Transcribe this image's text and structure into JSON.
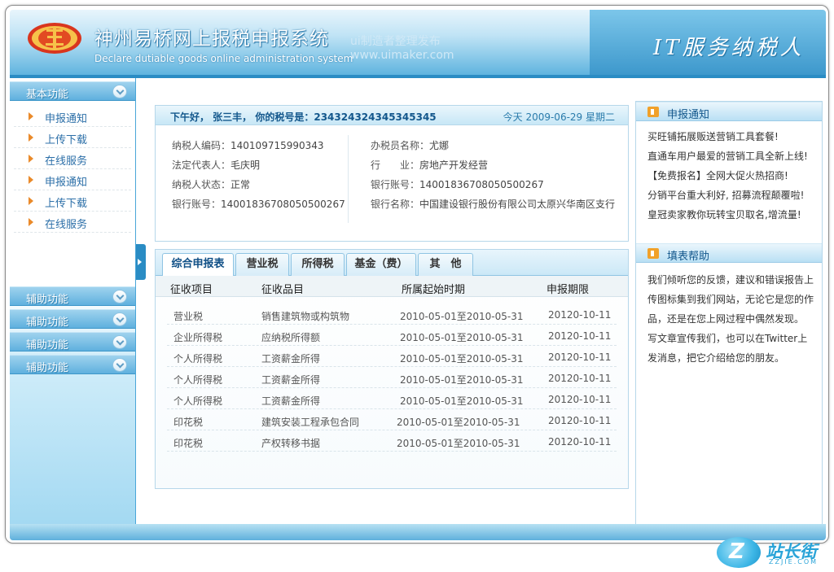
{
  "header": {
    "title": "神州易桥网上报税申报系统",
    "subtitle": "Declare dutiable goods online administration system",
    "watermark_line1": "ui制造者整理发布",
    "watermark_line2": "www.uimaker.com",
    "slogan": "IT服务纳税人",
    "logo_icon": "tax-emblem-icon"
  },
  "sidebar": {
    "basic_title": "基本功能",
    "items": [
      {
        "label": "申报通知"
      },
      {
        "label": "上传下载"
      },
      {
        "label": "在线服务"
      },
      {
        "label": "申报通知"
      },
      {
        "label": "上传下载"
      },
      {
        "label": "在线服务"
      }
    ],
    "aux_sections": [
      {
        "label": "辅助功能"
      },
      {
        "label": "辅助功能"
      },
      {
        "label": "辅助功能"
      },
      {
        "label": "辅助功能"
      }
    ]
  },
  "info": {
    "greeting": "下午好，   张三丰， 你的税号是：234324324345345345",
    "date": "今天  2009-06-29  星期二",
    "left": [
      {
        "key": "纳税人编码：",
        "value": "140109715990343"
      },
      {
        "key": "法定代表人：",
        "value": "毛庆明"
      },
      {
        "key": "纳税人状态：",
        "value": "正常"
      },
      {
        "key": "银行账号：",
        "value": "14001836708050500267"
      }
    ],
    "right": [
      {
        "key": "办税员名称：",
        "value": "尤娜"
      },
      {
        "key": "行　　业：",
        "value": "房地产开发经营"
      },
      {
        "key": "银行账号：",
        "value": "14001836708050500267"
      },
      {
        "key": "银行名称：",
        "value": "中国建设银行股份有限公司太原兴华南区支行"
      }
    ]
  },
  "tabs": [
    {
      "label": "综合申报表",
      "active": true
    },
    {
      "label": "营业税",
      "active": false
    },
    {
      "label": "所得税",
      "active": false
    },
    {
      "label": "基金（费）",
      "active": false
    },
    {
      "label": "其　他",
      "active": false
    }
  ],
  "table": {
    "columns": [
      "征收项目",
      "征收品目",
      "所属起始时期",
      "申报期限"
    ],
    "rows": [
      [
        "营业税",
        "销售建筑物或构筑物",
        "2010-05-01至2010-05-31",
        "20120-10-11"
      ],
      [
        "企业所得税",
        "应纳税所得额",
        "2010-05-01至2010-05-31",
        "20120-10-11"
      ],
      [
        "个人所得税",
        "工资薪金所得",
        "2010-05-01至2010-05-31",
        "20120-10-11"
      ],
      [
        "个人所得税",
        "工资薪金所得",
        "2010-05-01至2010-05-31",
        "20120-10-11"
      ],
      [
        "个人所得税",
        "工资薪金所得",
        "2010-05-01至2010-05-31",
        "20120-10-11"
      ],
      [
        "印花税",
        "建筑安装工程承包合同",
        "2010-05-01至2010-05-31",
        "20120-10-11"
      ],
      [
        "印花税",
        "产权转移书据",
        "2010-05-01至2010-05-31",
        "20120-10-11"
      ]
    ]
  },
  "right_panel": {
    "news_title": "申报通知",
    "news": [
      "买旺铺拓展贩送营销工具套餐!",
      "直通车用户最爱的营销工具全新上线!",
      "【免费报名】全网大促火热招商!",
      "分销平台重大利好, 招募流程颠覆啦!",
      "皇冠卖家教你玩转宝贝取名,增流量!"
    ],
    "help_title": "填表帮助",
    "help_text": "我们倾听您的反馈，建议和错误报告上传图标集到我们网站，无论它是您的作品，还是在您上网过程中偶然发现。",
    "help_text2": "写文章宣传我们，也可以在Twitter上发消息，把它介绍给您的朋友。"
  },
  "brand": {
    "glyph": "Z",
    "name": "站长街",
    "url": "ZZJIE.COM"
  }
}
